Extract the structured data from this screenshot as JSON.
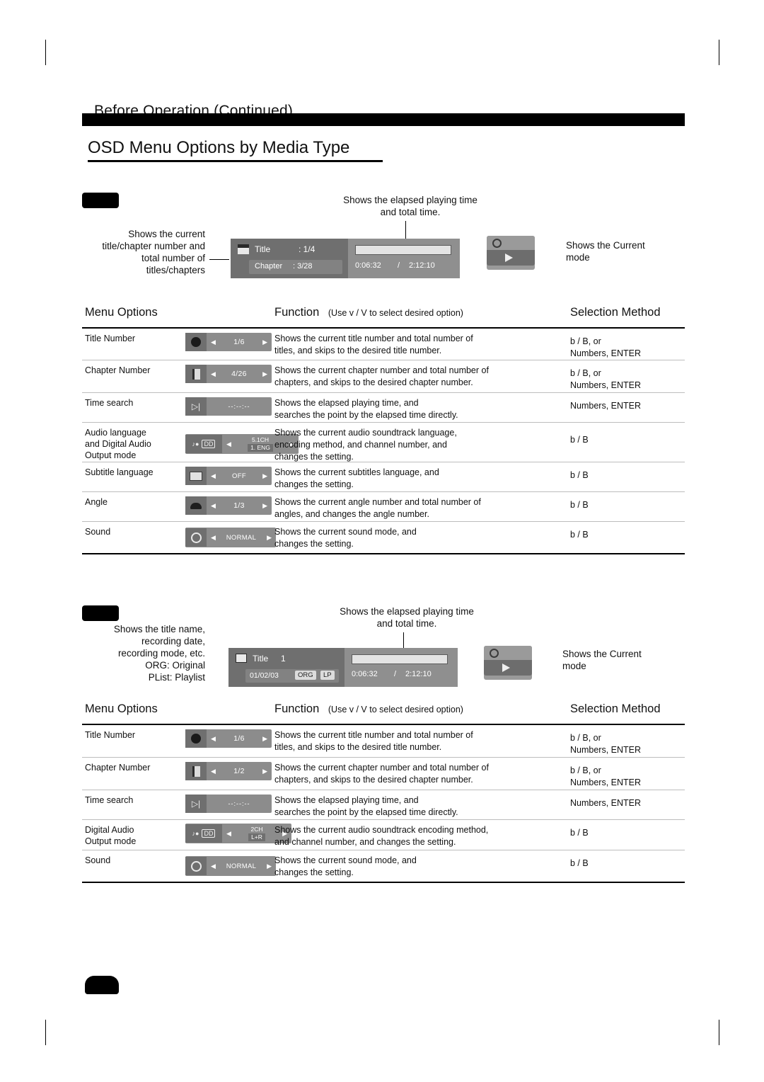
{
  "header": {
    "section_title": "Before Operation (Continued)",
    "page_heading": "OSD Menu Options by Media Type"
  },
  "block1": {
    "callout_top": "Shows the elapsed playing time\nand total time.",
    "callout_left": "Shows the current\ntitle/chapter number and\ntotal number of\ntitles/chapters",
    "callout_right": "Shows the Current\nmode",
    "osd": {
      "title_label": "Title",
      "title_value": ": 1/4",
      "chapter_label": "Chapter",
      "chapter_value": ": 3/28",
      "elapsed": "0:06:32",
      "separator": "/",
      "total": "2:12:10",
      "play_icon": "play-icon",
      "disc_icon": "disc-icon"
    },
    "table": {
      "col1": "Menu Options",
      "col2": "Function",
      "col2_note": "(Use v / V to select desired option)",
      "col3": "Selection Method",
      "rows": [
        {
          "name": "Title Number",
          "widget": {
            "icon": "title-dot-icon",
            "value": "1/6",
            "arrows": true
          },
          "function": "Shows the current title number and total number of\ntitles, and  skips to the desired title number.",
          "method": "b / B, or\nNumbers, ENTER"
        },
        {
          "name": "Chapter Number",
          "widget": {
            "icon": "chapter-icon",
            "value": "4/26",
            "arrows": true
          },
          "function": "Shows the current chapter number and total number of\nchapters, and  skips to the desired chapter number.",
          "method": "b / B, or\nNumbers, ENTER"
        },
        {
          "name": "Time search",
          "widget": {
            "icon": "time-icon",
            "value": "--:--:--",
            "arrows": false
          },
          "function": "Shows the elapsed playing time, and\nsearches the point by the elapsed time directly.",
          "method": "Numbers, ENTER"
        },
        {
          "name": "Audio language\nand Digital Audio\nOutput mode",
          "widget": {
            "icon": "audio-icon",
            "value": "5.1CH",
            "value2": "1.   ENG",
            "arrows": true
          },
          "function": "Shows the current audio soundtrack language,\nencoding method, and channel number, and\nchanges the setting.",
          "method": "b / B"
        },
        {
          "name": "Subtitle language",
          "widget": {
            "icon": "subtitle-icon",
            "value": "OFF",
            "arrows": true
          },
          "function": "Shows the current subtitles language, and\nchanges the setting.",
          "method": "b / B"
        },
        {
          "name": "Angle",
          "widget": {
            "icon": "angle-icon",
            "value": "1/3",
            "arrows": true
          },
          "function": "Shows the current angle number and total number of\nangles, and  changes the angle number.",
          "method": "b / B"
        },
        {
          "name": "Sound",
          "widget": {
            "icon": "sound-icon",
            "value": "NORMAL",
            "arrows": true
          },
          "function": "Shows the current sound mode, and\nchanges the setting.",
          "method": "b / B"
        }
      ]
    }
  },
  "block2": {
    "callout_top": "Shows the elapsed playing time\nand total time.",
    "callout_left": "Shows the title name,\nrecording date,\nrecording mode, etc.\nORG: Original\nPList: Playlist",
    "callout_right": "Shows the Current\nmode",
    "osd": {
      "title_label": "Title",
      "title_value": "1",
      "date": "01/02/03",
      "badge1": "ORG",
      "badge2": "LP",
      "elapsed": "0:06:32",
      "separator": "/",
      "total": "2:12:10",
      "play_icon": "play-icon",
      "disc_icon": "disc-icon"
    },
    "table": {
      "col1": "Menu Options",
      "col2": "Function",
      "col2_note": "(Use v / V to select desired option)",
      "col3": "Selection Method",
      "rows": [
        {
          "name": "Title Number",
          "widget": {
            "icon": "title-dot-icon",
            "value": "1/6",
            "arrows": true
          },
          "function": "Shows the current title number and total number of\ntitles, and  skips to the desired title number.",
          "method": "b / B, or\nNumbers, ENTER"
        },
        {
          "name": "Chapter Number",
          "widget": {
            "icon": "chapter-icon",
            "value": "1/2",
            "arrows": true
          },
          "function": "Shows the current chapter number and total number of\nchapters, and  skips to the desired chapter number.",
          "method": "b / B, or\nNumbers, ENTER"
        },
        {
          "name": "Time search",
          "widget": {
            "icon": "time-icon",
            "value": "--:--:--",
            "arrows": false
          },
          "function": "Shows the elapsed playing time, and\nsearches the point by the elapsed time directly.",
          "method": "Numbers, ENTER"
        },
        {
          "name": "Digital Audio\nOutput mode",
          "widget": {
            "icon": "audio-icon",
            "value": "2CH",
            "value2": "L+R",
            "arrows": true
          },
          "function": "Shows the current audio soundtrack encoding method,\nand channel number, and   changes the setting.",
          "method": "b / B"
        },
        {
          "name": "Sound",
          "widget": {
            "icon": "sound-icon",
            "value": "NORMAL",
            "arrows": true
          },
          "function": "Shows the current sound mode, and\nchanges the setting.",
          "method": "b / B"
        }
      ]
    }
  }
}
